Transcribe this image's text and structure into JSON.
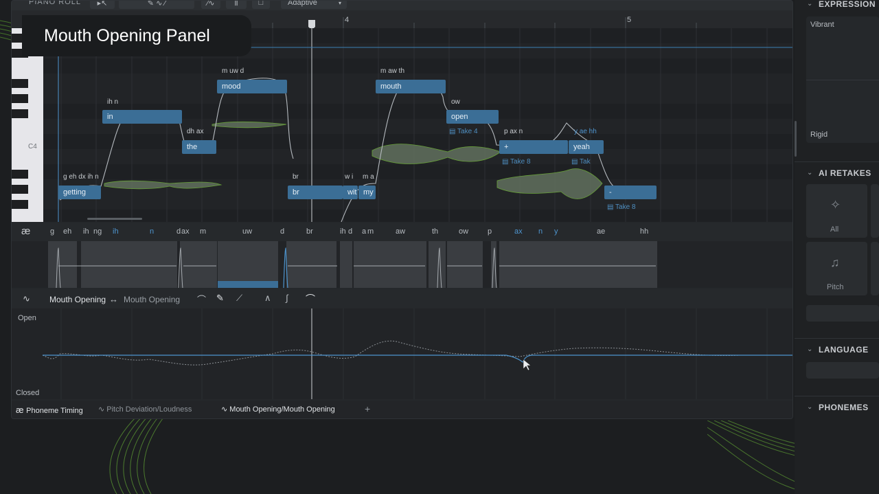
{
  "toolbar": {
    "title": "PIANO ROLL",
    "mode": "Adaptive"
  },
  "overlay_title": "Mouth Opening Panel",
  "ruler": {
    "marks": [
      "4",
      "5"
    ]
  },
  "keys": {
    "c4": "C4"
  },
  "notes": [
    {
      "text": "getting",
      "phonemes": "g eh dx ih n"
    },
    {
      "text": "in",
      "phonemes": "ih n"
    },
    {
      "text": "the",
      "phonemes": "dh ax"
    },
    {
      "text": "mood",
      "phonemes": "m uw d"
    },
    {
      "text": "br",
      "phonemes": "br"
    },
    {
      "text": "wit",
      "phonemes": "w i"
    },
    {
      "text": "my",
      "phonemes": "m a"
    },
    {
      "text": "mouth",
      "phonemes": "m aw th"
    },
    {
      "text": "open",
      "phonemes": "ow"
    },
    {
      "text": "+",
      "phonemes": "p ax n"
    },
    {
      "text": "yeah",
      "phonemes": "y ae hh"
    },
    {
      "text": "-",
      "phonemes": ""
    }
  ],
  "takes": [
    "Take 4",
    "Take 8",
    "Tak",
    "Take 8"
  ],
  "phoneme_lane": {
    "icon": "æ",
    "phonemes": [
      "g",
      "eh",
      "ih",
      "ng",
      "ih",
      "n",
      "d",
      "ax",
      "m",
      "uw",
      "d",
      "br",
      "ih",
      "d",
      "a",
      "m",
      "aw",
      "th",
      "ow",
      "p",
      "ax",
      "n",
      "y",
      "ae",
      "hh"
    ]
  },
  "mouth_panel": {
    "param_from": "Mouth Opening",
    "arrow": "↔",
    "param_to": "Mouth Opening",
    "label_open": "Open",
    "label_closed": "Closed"
  },
  "bottom_tabs": {
    "tab1": "Phoneme Timing",
    "tab2": "Pitch Deviation/Loudness",
    "tab3": "Mouth Opening/Mouth Opening",
    "add": "+"
  },
  "right_panel": {
    "expression": "EXPRESSION",
    "vibrant": "Vibrant",
    "rigid": "Rigid",
    "ai_retakes": "AI RETAKES",
    "all": "All",
    "pitch": "Pitch",
    "language": "LANGUAGE",
    "phonemes": "PHONEMES"
  },
  "colors": {
    "accent": "#3b6e96",
    "wave": "#6fae3a",
    "line": "#4e95cf"
  }
}
